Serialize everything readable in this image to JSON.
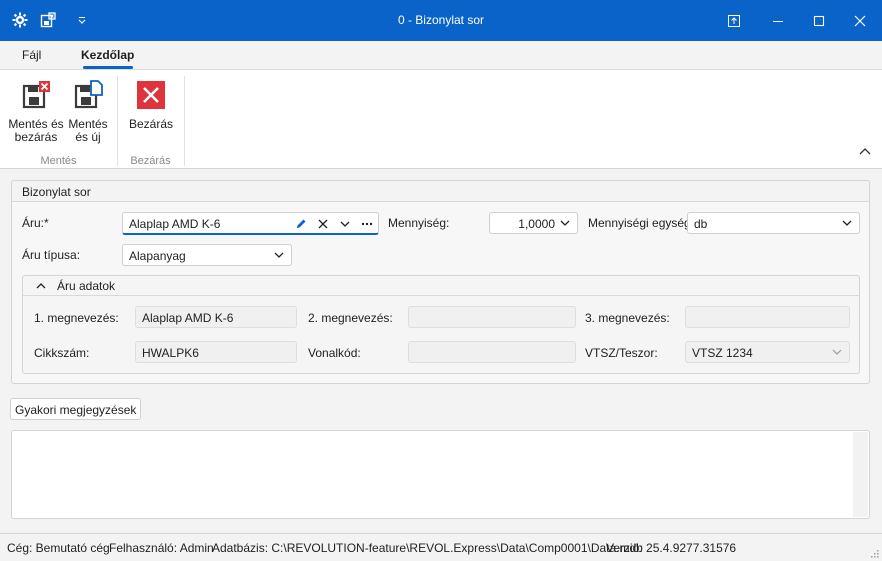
{
  "window": {
    "title": "0 - Bizonylat sor"
  },
  "tabs": [
    {
      "label": "Fájl",
      "active": false
    },
    {
      "label": "Kezdőlap",
      "active": true
    }
  ],
  "ribbon": {
    "save_close_label1": "Mentés és",
    "save_close_label2": "bezárás",
    "save_new_label1": "Mentés",
    "save_new_label2": "és új",
    "close_label": "Bezárás",
    "group_save": "Mentés",
    "group_close": "Bezárás"
  },
  "form": {
    "section_title": "Bizonylat sor",
    "item_label": "Áru:*",
    "item_value": "Alaplap AMD K-6",
    "quantity_label": "Mennyiség:",
    "quantity_value": "1,0000",
    "unit_label": "Mennyiségi egység:",
    "unit_value": "db",
    "type_label": "Áru típusa:",
    "type_value": "Alapanyag",
    "details": {
      "title": "Áru adatok",
      "name1_label": "1. megnevezés:",
      "name1_value": "Alaplap AMD K-6",
      "name2_label": "2. megnevezés:",
      "name2_value": "",
      "name3_label": "3. megnevezés:",
      "name3_value": "",
      "sku_label": "Cikkszám:",
      "sku_value": "HWALPK6",
      "barcode_label": "Vonalkód:",
      "barcode_value": "",
      "vtsz_label": "VTSZ/Teszor:",
      "vtsz_value": "VTSZ 1234"
    }
  },
  "notes": {
    "button_label": "Gyakori megjegyzések",
    "text": ""
  },
  "status": {
    "company": "Cég: Bemutató cég",
    "user": "Felhasználó: Admin",
    "database": "Adatbázis: C:\\REVOLUTION-feature\\REVOL.Express\\Data\\Comp0001\\Data.mdb",
    "version": "Verzió: 25.4.9277.31576"
  },
  "colors": {
    "accent": "#0a63c9",
    "close_red": "#e0343c"
  }
}
